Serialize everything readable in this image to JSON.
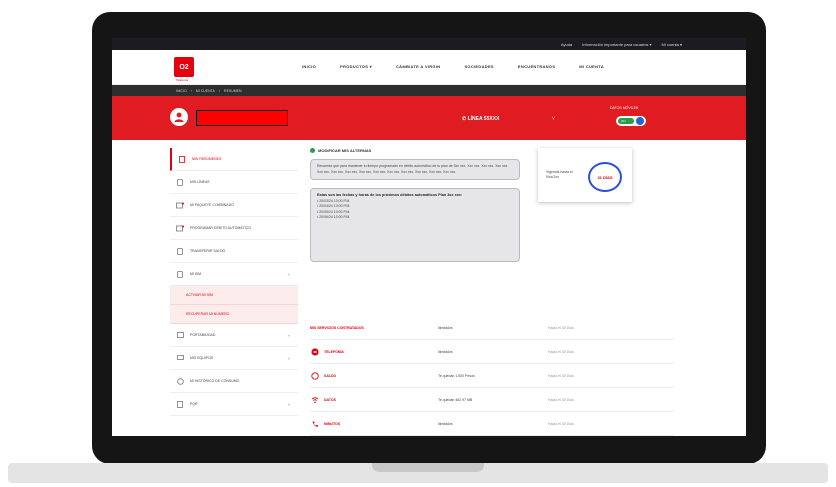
{
  "topbar": {
    "items": [
      "Ayuda",
      "Información importante para usuarios ▾",
      "Mi cuenta ▾"
    ]
  },
  "nav": {
    "logo_text": "O2",
    "logo_sub": "Telefonía",
    "links": [
      "INICIO",
      "PRODUCTOS ▾",
      "CÁMBIATE A VIRGIN",
      "SOCIEDADES",
      "ENCUÉNTRANOS",
      "MI CUENTA"
    ]
  },
  "breadcrumb": [
    "INICIO",
    "›",
    "MI CUENTA",
    "›",
    "RESUMEN"
  ],
  "header": {
    "phone_label": "LÍNEA 55XXX",
    "chevron": "˅",
    "data_label": "DATOS MÓVILES",
    "toggle_label": "ON"
  },
  "sidebar": {
    "items": [
      {
        "label": "MIS RESÚMENES",
        "active": true
      },
      {
        "label": "MIS LÍNEAS"
      },
      {
        "label": "MI PAQUETE COMBINADO"
      },
      {
        "label": "PROGRAMAR DÉBITO AUTOMÁTICO"
      },
      {
        "label": "TRANSFERIR SALDO"
      },
      {
        "label": "MI SIM",
        "chevron": "˅"
      }
    ],
    "subitems": [
      "ACTIVAR MI SIM",
      "RECUPERAR MI NÚMERO"
    ],
    "items2": [
      {
        "label": "PORTABILIDAD",
        "chevron": "˅"
      },
      {
        "label": "MIS EQUIPOS",
        "chevron": "˅"
      },
      {
        "label": "MI HISTÓRICO DE CONSUMO"
      },
      {
        "label": "PQR",
        "chevron": "˅"
      }
    ]
  },
  "auto": {
    "title": "MODIFICAR MIS ALTERNAS",
    "desc": "Recuerda que para mantener tu tiempo programado en débito automático de tu plan de 3xx xxx. Xxx xxx. Xxx xxx. Xxx xxx. Xxx xxx. Xxx xxx. Xxx xxx. Xxx xxx. Xxx xxx. Xxx xxx. Xxx xxx. Xxx xxx. Xxx xxx. Xxx xxx.",
    "dates_title": "Estas son las fechas y horas de los próximos débitos automáticos Plan 3xx xxx:",
    "dates": [
      "20/03/24 10:00 P.M.",
      "20/04/24 10:00 P.M.",
      "20/05/24 10:00 P.M.",
      "20/06/24 10:00 P.M."
    ]
  },
  "vigencia": {
    "label": "Vigencia hasta el 5/xx/2xx",
    "value": "31 DÍAS"
  },
  "usage": {
    "header": [
      "MIS SERVICIOS CONTRATADOS",
      "Ilimitados",
      "Hasta el 30 Días"
    ],
    "rows": [
      {
        "name": "TELEFONÍA",
        "value": "Ilimitados",
        "note": "Hasta el 30 Días",
        "icon": "phone-icon"
      },
      {
        "name": "SALDO",
        "value": "Te quedan 1.500 Pesos",
        "note": "Hasta el 30 Días",
        "icon": "money-icon"
      },
      {
        "name": "DATOS",
        "value": "Te quedan 462.97 MB",
        "note": "Hasta el 30 Días",
        "icon": "wifi-icon"
      },
      {
        "name": "MINUTOS",
        "value": "Ilimitados",
        "note": "Hasta el 30 Días",
        "icon": "call-icon"
      }
    ]
  },
  "colors": {
    "brand": "#e01b22",
    "accent_blue": "#2b50e0",
    "ok_green": "#2a9d49"
  }
}
